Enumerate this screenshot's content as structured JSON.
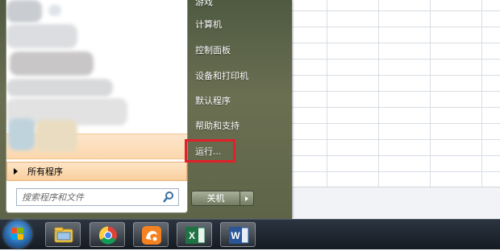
{
  "start_menu": {
    "right_items": [
      {
        "label": "游戏"
      },
      {
        "label": "计算机"
      },
      {
        "label": "控制面板"
      },
      {
        "label": "设备和打印机"
      },
      {
        "label": "默认程序"
      },
      {
        "label": "帮助和支持"
      },
      {
        "label": "运行..."
      }
    ],
    "all_programs_label": "所有程序",
    "search_placeholder": "搜索程序和文件",
    "shutdown_label": "关机"
  },
  "taskbar": {
    "apps": [
      {
        "icon": "windows-explorer-icon"
      },
      {
        "icon": "chrome-icon"
      },
      {
        "icon": "uc-browser-icon"
      },
      {
        "icon": "excel-icon",
        "letter": "X"
      },
      {
        "icon": "word-icon",
        "letter": "W"
      }
    ]
  },
  "colors": {
    "highlight_red": "#e0202a",
    "menu_bg": "#5d6448",
    "taskbar_bg": "#151b22"
  }
}
